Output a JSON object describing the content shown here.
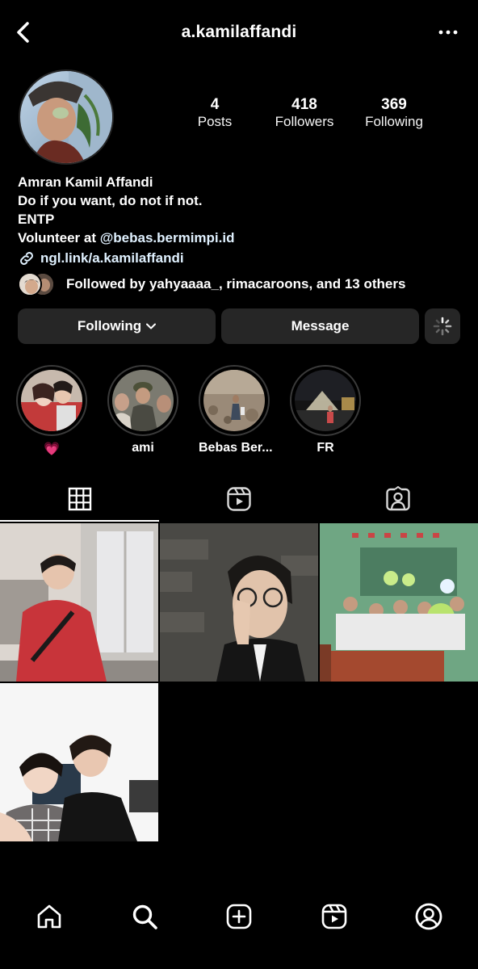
{
  "header": {
    "username": "a.kamilaffandi",
    "back_icon": "chevron-left-icon",
    "more_icon": "more-horizontal-icon"
  },
  "stats": {
    "posts": {
      "value": "4",
      "label": "Posts"
    },
    "followers": {
      "value": "418",
      "label": "Followers"
    },
    "following": {
      "value": "369",
      "label": "Following"
    }
  },
  "bio": {
    "name": "Amran Kamil Affandi",
    "line1": "Do if you want, do not if not.",
    "line2": "ENTP",
    "line3_prefix": "Volunteer at ",
    "line3_mention": "@bebas.bermimpi.id",
    "link": "ngl.link/a.kamilaffandi"
  },
  "followed_by": "Followed by yahyaaaa_, rimacaroons, and 13 others",
  "buttons": {
    "following": "Following",
    "message": "Message"
  },
  "highlights": [
    {
      "label": "💗"
    },
    {
      "label": "ami"
    },
    {
      "label": "Bebas Ber..."
    },
    {
      "label": "FR"
    }
  ],
  "tabs": [
    "grid-icon",
    "reels-icon",
    "tagged-icon"
  ],
  "posts_count_shown": 4,
  "nav": [
    "home-icon",
    "search-icon",
    "create-icon",
    "reels-icon",
    "profile-icon"
  ],
  "colors": {
    "background": "#000000",
    "button": "#262626",
    "link": "#e0f1ff"
  }
}
